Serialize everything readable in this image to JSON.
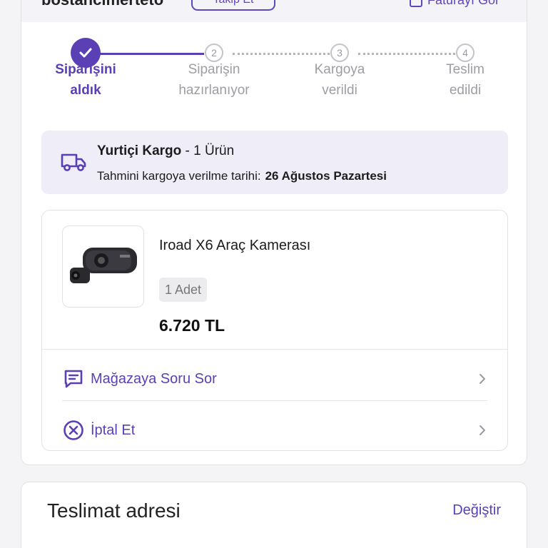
{
  "seller": {
    "name": "bostancimerteto",
    "follow_label": "Takip Et",
    "invoice_label": "Faturayı Gör"
  },
  "steps": [
    {
      "number": "",
      "label_line1": "Siparişini",
      "label_line2": "aldık",
      "state": "done"
    },
    {
      "number": "2",
      "label_line1": "Siparişin",
      "label_line2": "hazırlanıyor",
      "state": "pending"
    },
    {
      "number": "3",
      "label_line1": "Kargoya",
      "label_line2": "verildi",
      "state": "pending"
    },
    {
      "number": "4",
      "label_line1": "Teslim",
      "label_line2": "edildi",
      "state": "pending"
    }
  ],
  "shipment": {
    "carrier": "Yurtiçi Kargo",
    "item_count": "- 1 Ürün",
    "estimate_label": "Tahmini kargoya verilme tarihi:",
    "estimate_date": "26 Ağustos Pazartesi"
  },
  "product": {
    "name": "Iroad X6 Araç Kamerası",
    "quantity": "1 Adet",
    "price": "6.720 TL"
  },
  "actions": {
    "ask_store": "Mağazaya Soru Sor",
    "cancel": "İptal Et"
  },
  "address": {
    "title": "Teslimat adresi",
    "change_label": "Değiştir"
  },
  "colors": {
    "accent": "#5b3fb4",
    "cargo_bg": "#efedf8"
  }
}
